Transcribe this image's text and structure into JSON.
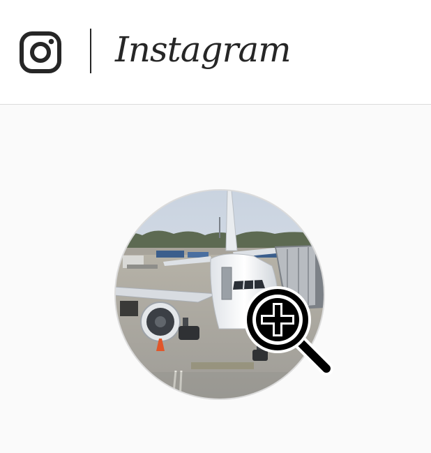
{
  "header": {
    "logo_icon": "instagram-camera-icon",
    "wordmark": "Instagram"
  },
  "profile": {
    "avatar_description": "airplane-at-gate-photo",
    "zoom_icon": "zoom-in-magnifier-icon"
  },
  "colors": {
    "header_bg": "#ffffff",
    "page_bg": "#fafafa",
    "border": "#dbdbdb",
    "icon": "#262626"
  }
}
